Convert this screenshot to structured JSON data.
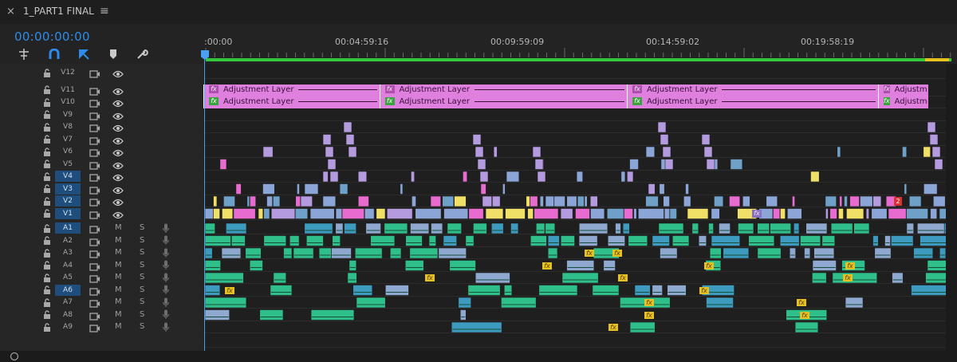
{
  "panel": {
    "close_glyph": "×",
    "title": "1_PART1 FINAL",
    "menu_glyph": "≡",
    "timecode": "00:00:00:00"
  },
  "tools": [
    {
      "name": "insert-edit-icon",
      "glyph": "⊹"
    },
    {
      "name": "snap-icon",
      "glyph": "∩"
    },
    {
      "name": "linked-selection-icon",
      "glyph": "◤"
    },
    {
      "name": "add-marker-icon",
      "glyph": "⬢"
    },
    {
      "name": "settings-wrench-icon",
      "glyph": "🔧"
    }
  ],
  "ruler": {
    "labels": [
      ":00:00",
      "00:04:59:16",
      "00:09:59:09",
      "00:14:59:02",
      "00:19:58:19"
    ]
  },
  "video_tracks": [
    {
      "label": "V12",
      "selected": false
    },
    {
      "label": "V11",
      "selected": false
    },
    {
      "label": "V10",
      "selected": false
    },
    {
      "label": "V9",
      "selected": false
    },
    {
      "label": "V8",
      "selected": false
    },
    {
      "label": "V7",
      "selected": false
    },
    {
      "label": "V6",
      "selected": false
    },
    {
      "label": "V5",
      "selected": false
    },
    {
      "label": "V4",
      "selected": true
    },
    {
      "label": "V3",
      "selected": true
    },
    {
      "label": "V2",
      "selected": true
    },
    {
      "label": "V1",
      "selected": true
    }
  ],
  "audio_tracks": [
    {
      "label": "A1",
      "selected": true
    },
    {
      "label": "A2",
      "selected": false
    },
    {
      "label": "A3",
      "selected": false
    },
    {
      "label": "A4",
      "selected": false
    },
    {
      "label": "A5",
      "selected": false
    },
    {
      "label": "A6",
      "selected": true
    },
    {
      "label": "A7",
      "selected": false
    },
    {
      "label": "A8",
      "selected": false
    },
    {
      "label": "A9",
      "selected": false
    }
  ],
  "mute_label": "M",
  "solo_label": "S",
  "adjustment_layers": [
    {
      "label": "Adjustment Layer",
      "start": 0.0,
      "end": 4.9
    },
    {
      "label": "Adjustment Layer",
      "start": 4.9,
      "end": 11.8
    },
    {
      "label": "Adjustment Layer",
      "start": 11.8,
      "end": 18.8
    },
    {
      "label": "Adjustm",
      "start": 18.8,
      "end": 20.2
    }
  ],
  "fx_glyph": "fx",
  "marker_count": "2",
  "colors": {
    "accent": "#2d8ceb",
    "adjustment": "#df80df",
    "video_blue": "#8aa5d6",
    "video_lilac": "#b49be0",
    "audio_green": "#2fbf8a",
    "fx_yellow": "#e6c220",
    "work_area": "#33c93a"
  }
}
